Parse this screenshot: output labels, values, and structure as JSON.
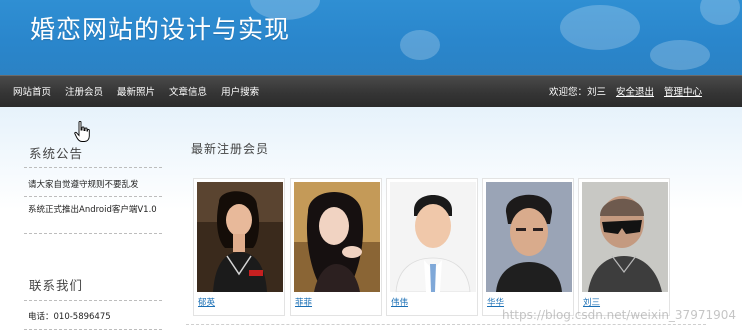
{
  "banner": {
    "title": "婚恋网站的设计与实现"
  },
  "nav": {
    "items": [
      "网站首页",
      "注册会员",
      "最新照片",
      "文章信息",
      "用户搜索"
    ],
    "welcome": "欢迎您：刘三",
    "logout": "安全退出",
    "admin": "管理中心"
  },
  "sidebar": {
    "announcement_title": "系统公告",
    "announcements": [
      "请大家自觉遵守规则不要乱发",
      "系统正式推出Android客户端V1.0"
    ],
    "contact_title": "联系我们",
    "phone": "电话：010-5896475"
  },
  "main": {
    "title": "最新注册会员",
    "members": [
      {
        "name": "郁英"
      },
      {
        "name": "菲菲"
      },
      {
        "name": "伟伟"
      },
      {
        "name": "华华"
      },
      {
        "name": "刘三"
      }
    ]
  },
  "watermark": "https://blog.csdn.net/weixin_37971904",
  "colors": {
    "banner": "#2b88cf",
    "nav": "#333333",
    "link": "#1a6fb5"
  },
  "cursor": "hand-pointer-icon"
}
